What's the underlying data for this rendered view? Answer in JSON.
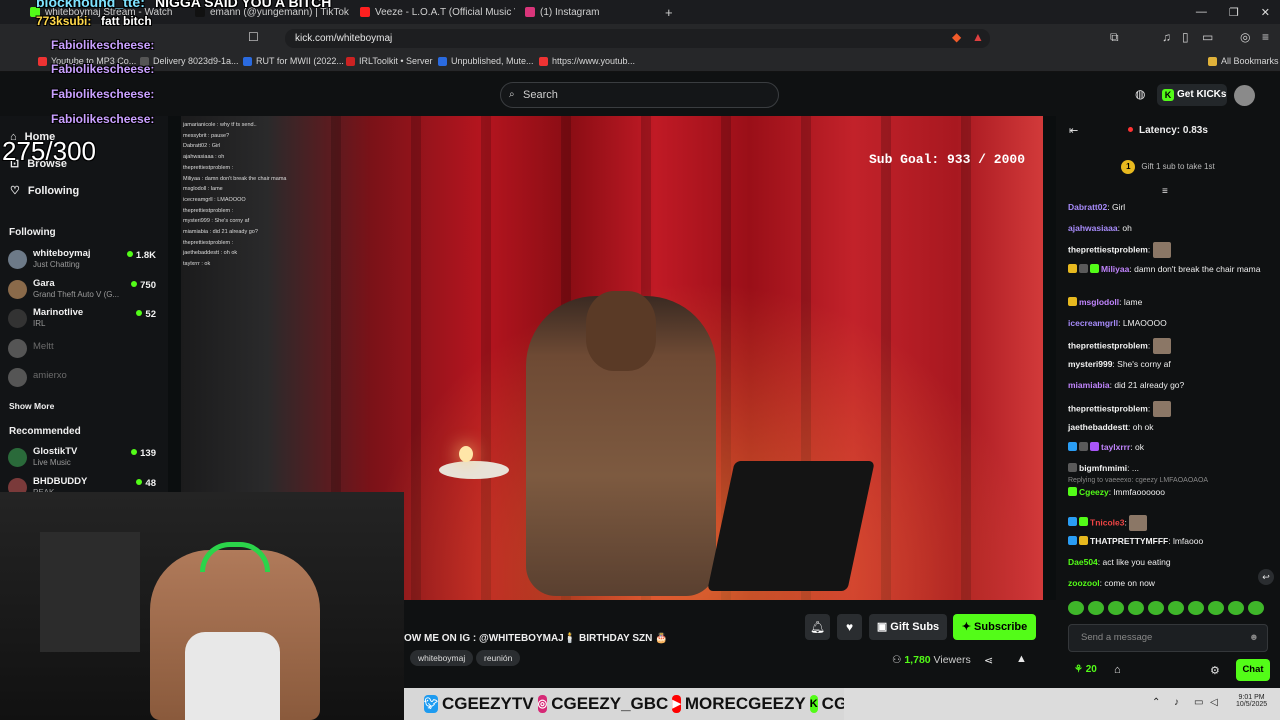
{
  "browser": {
    "tabs": [
      {
        "title": "whiteboymaj Stream - Watch",
        "color": "#53fc18"
      },
      {
        "title": "emann (@yungemann) | TikTok",
        "color": "#111111"
      },
      {
        "title": "Veeze - L.O.A.T (Official Music Video)",
        "color": "#ff2020"
      },
      {
        "title": "(1) Instagram",
        "color": "#d9357a"
      }
    ],
    "url": "kick.com/whiteboymaj",
    "bookmarks": [
      "Youtube to MP3 Co...",
      "Delivery 8023d9-1a...",
      "RUT for MWII (2022...",
      "IRLToolkit • Server",
      "Unpublished, Mute...",
      "https://www.youtub..."
    ],
    "all_bookmarks": "All Bookmarks"
  },
  "header": {
    "search_placeholder": "Search",
    "get_kicks": "Get KICKs"
  },
  "sidebar": {
    "nav": [
      "Home",
      "Browse",
      "Following"
    ],
    "following_title": "Following",
    "following": [
      {
        "name": "whiteboymaj",
        "sub": "Just Chatting",
        "viewers": "1.8K",
        "color": "#6d7a88"
      },
      {
        "name": "Gara",
        "sub": "Grand Theft Auto V (G...",
        "viewers": "750",
        "color": "#8a6a4a"
      },
      {
        "name": "Marinotlive",
        "sub": "IRL",
        "viewers": "52",
        "color": "#333333"
      },
      {
        "name": "Meltt",
        "sub": "",
        "viewers": "",
        "color": "#555555"
      },
      {
        "name": "amierxo",
        "sub": "",
        "viewers": "",
        "color": "#555555"
      }
    ],
    "show_more": "Show More",
    "recommended_title": "Recommended",
    "recommended": [
      {
        "name": "GlostikTV",
        "sub": "Live Music",
        "viewers": "139",
        "color": "#2a6a3a"
      },
      {
        "name": "BHDBUDDY",
        "sub": "PEAK",
        "viewers": "48",
        "color": "#7a3a3a"
      }
    ]
  },
  "overlay": {
    "top_alert": "NIGGA SAID YOU A BITCH",
    "alert_user": "blockhound_tte:",
    "sub_line_user": "773ksubi:",
    "sub_line_msg": "fatt bitch",
    "repeat_user": "Fabiolikescheese:",
    "sub_counter": "275/300"
  },
  "video": {
    "sub_goal": "Sub Goal:  933 / 2000",
    "overlay_chat": [
      "jamarianicole : why tf ts send..",
      "messybrit : pause?",
      "Dabratt02 : Girl",
      "ajahwasiaaa : oh",
      "theprettiestproblem :",
      "Miliyaa : damn don't break the chair mama",
      "msglodoll : lame",
      "icecreamgrll : LMAOOOO",
      "theprettiestproblem :",
      "mysteri999 : She's corny af",
      "miamiabia : did 21 already go?",
      "theprettiestproblem :",
      "jaethebaddestt : oh ok",
      "taylxrrr : ok"
    ]
  },
  "stream_info": {
    "ig_line": "OW ME ON IG : @WHITEBOYMAJ🕯️ BIRTHDAY SZN 🎂",
    "tags": [
      "whiteboymaj",
      "reunión"
    ],
    "gift_subs": "Gift Subs",
    "subscribe": "Subscribe",
    "viewers_count": "1,780",
    "viewers_label": "Viewers"
  },
  "chat": {
    "latency": "Latency: 0.83s",
    "gift_prompt": "Gift 1 sub to take 1st",
    "gift_rank": "1",
    "messages": [
      {
        "user": "Dabratt02",
        "text": "Girl",
        "color": "#a78bfa"
      },
      {
        "user": "ajahwasiaaa",
        "text": "oh",
        "color": "#a78bfa"
      },
      {
        "user": "theprettiestproblem",
        "text": "",
        "color": "#f2f2f2",
        "emote": true
      },
      {
        "user": "Miliyaa",
        "text": "damn don't break the chair mama",
        "color": "#c084fc",
        "badges": [
          "#e7b91f",
          "#5a5a5a",
          "#53fc18"
        ]
      },
      {
        "user": "msglodoll",
        "text": "lame",
        "color": "#c084fc",
        "badges": [
          "#e7b91f"
        ]
      },
      {
        "user": "icecreamgrll",
        "text": "LMAOOOO",
        "color": "#a78bfa"
      },
      {
        "user": "theprettiestproblem",
        "text": "",
        "color": "#f2f2f2",
        "emote": true
      },
      {
        "user": "mysteri999",
        "text": "She's corny af",
        "color": "#f2f2f2"
      },
      {
        "user": "miamiabia",
        "text": "did 21 already go?",
        "color": "#c084fc"
      },
      {
        "user": "theprettiestproblem",
        "text": "",
        "color": "#f2f2f2",
        "emote": true
      },
      {
        "user": "jaethebaddestt",
        "text": "oh ok",
        "color": "#f2f2f2"
      },
      {
        "user": "taylxrrr",
        "text": "ok",
        "color": "#c084fc",
        "badges": [
          "#2a9df4",
          "#5a5a5a",
          "#a855f7"
        ]
      },
      {
        "user": "bigmfnmimi",
        "text": "...",
        "color": "#f2f2f2",
        "badges": [
          "#5a5a5a"
        ]
      },
      {
        "user": "Cgeezy",
        "text": "lmmfaoooooo",
        "color": "#53fc18",
        "badges": [
          "#53fc18"
        ],
        "reply": "Replying to vaeeexo: cgeezy LMFAOAOAOA"
      },
      {
        "user": "Tnicole3",
        "text": "",
        "color": "#ef4444",
        "badges": [
          "#2a9df4",
          "#53fc18"
        ],
        "emote": true
      },
      {
        "user": "THATPRETTYMFFF",
        "text": "lmfaooo",
        "color": "#f2f2f2",
        "badges": [
          "#2a9df4",
          "#e7b91f"
        ]
      },
      {
        "user": "Dae504",
        "text": "act like you eating",
        "color": "#53fc18"
      },
      {
        "user": "zoozool",
        "text": "come on now",
        "color": "#53fc18"
      }
    ],
    "input_placeholder": "Send a message",
    "points": "20",
    "chat_button": "Chat"
  },
  "socials_bar": {
    "twitter": "CGEEZYTV",
    "instagram": "CGEEZY_GBC",
    "youtube": "MORECGEEZY",
    "kick": "CGEEZY"
  },
  "taskbar": {
    "time": "9:01 PM",
    "date": "10/5/2025"
  }
}
